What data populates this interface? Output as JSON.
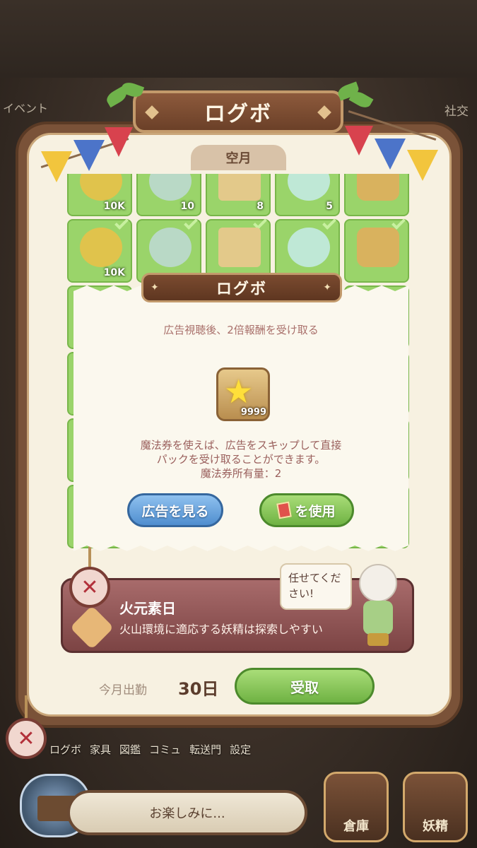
{
  "background": {
    "left_event_label": "イベント",
    "right_social_label": "社交",
    "bottom_tabs": [
      "ログボ",
      "家具",
      "図鑑",
      "コミュ",
      "転送門",
      "設定"
    ],
    "message_bar": "お楽しみに...",
    "warehouse_label": "倉庫",
    "fairy_label": "妖精"
  },
  "panel": {
    "title": "ログボ",
    "month_tab": "空月",
    "grid_rows": [
      [
        {
          "qty": "10K"
        },
        {
          "qty": "10"
        },
        {
          "qty": "8"
        },
        {
          "qty": "5"
        },
        {
          "qty": ""
        }
      ],
      [
        {
          "qty": "10K"
        },
        {
          "qty": ""
        },
        {
          "qty": ""
        },
        {
          "qty": ""
        },
        {
          "qty": ""
        }
      ]
    ],
    "day_banner": {
      "title": "火元素日",
      "description": "火山環境に適応する妖精は探索しやすい"
    },
    "speech_bubble": "任せてください!",
    "attendance_label": "今月出勤",
    "attendance_value": "30日",
    "receive_button": "受取"
  },
  "popup": {
    "title": "ログボ",
    "message": "広告視聴後、2倍報酬を受け取る",
    "reward_qty": "9999",
    "note_line1": "魔法券を使えば、広告をスキップして直接",
    "note_line2": "パックを受け取ることができます。",
    "note_line3": "魔法券所有量：2",
    "watch_ad_button": "広告を見る",
    "use_ticket_button": "を使用"
  },
  "colors": {
    "grid_green": "#9ad46a",
    "banner_red": "#a86b6b",
    "accent_brown": "#7a5238"
  }
}
